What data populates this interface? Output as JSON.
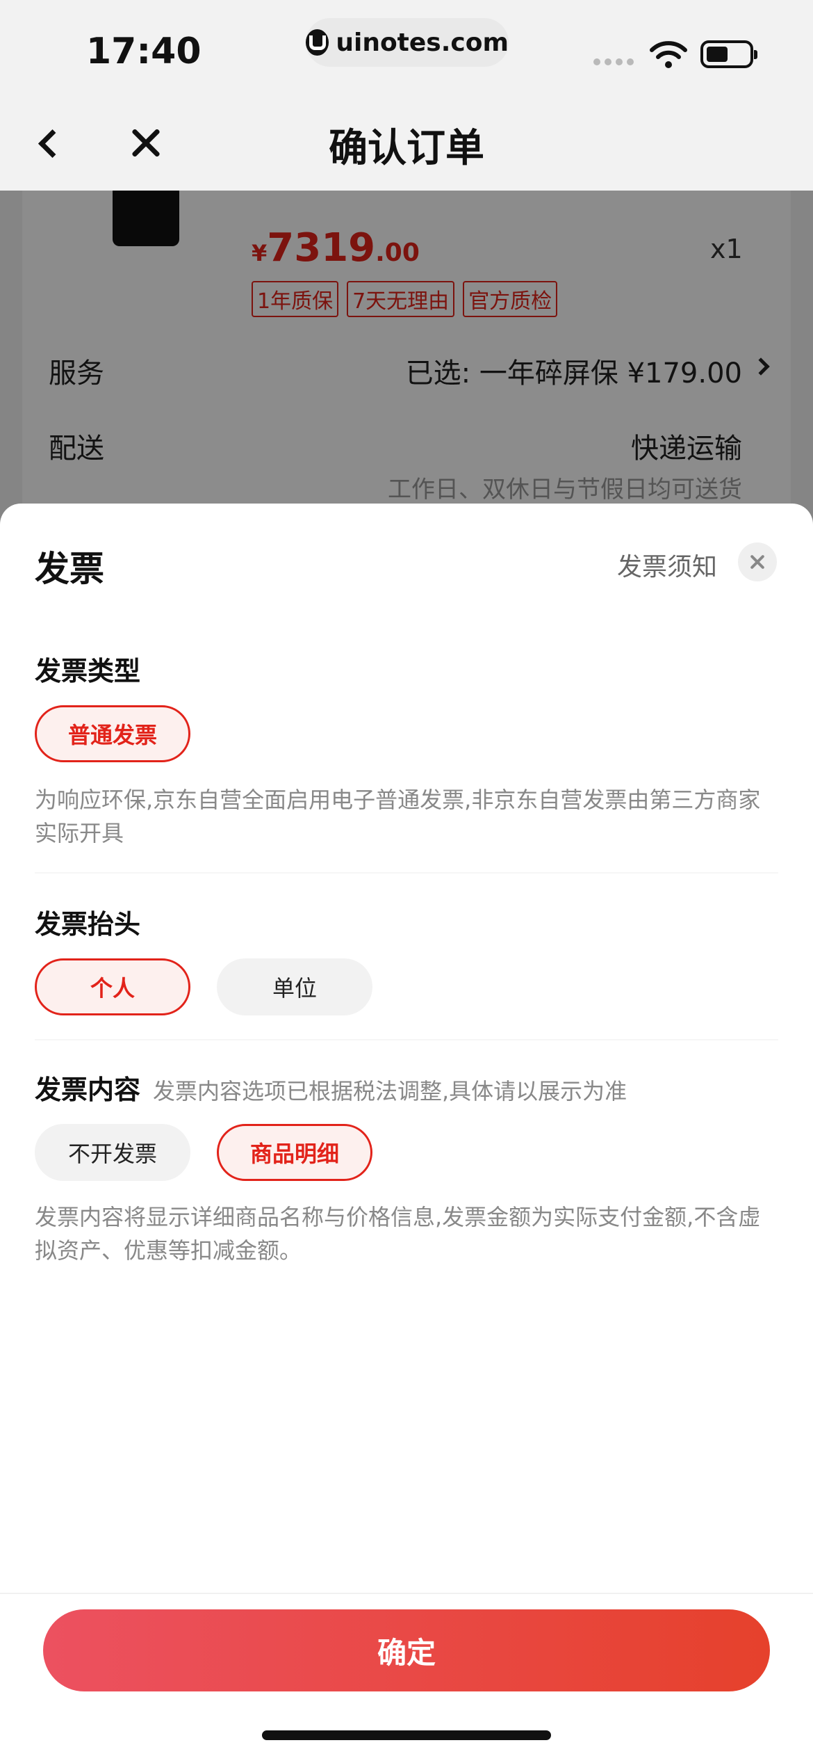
{
  "status_bar": {
    "time": "17:40",
    "url": "uinotes.com"
  },
  "nav": {
    "title": "确认订单"
  },
  "order": {
    "price_symbol": "¥",
    "price_integer": "7319",
    "price_decimal": ".00",
    "quantity": "x1",
    "tags": [
      "1年质保",
      "7天无理由",
      "官方质检"
    ],
    "service_label": "服务",
    "service_value": "已选: 一年碎屏保  ¥179.00",
    "delivery_label": "配送",
    "delivery_value": "快递运输",
    "delivery_note": "工作日、双休日与节假日均可送货"
  },
  "sheet": {
    "title": "发票",
    "notice_link": "发票须知",
    "invoice_type": {
      "title": "发票类型",
      "options": [
        "普通发票"
      ],
      "selected": "普通发票",
      "description": "为响应环保,京东自营全面启用电子普通发票,非京东自营发票由第三方商家实际开具"
    },
    "invoice_header": {
      "title": "发票抬头",
      "options": [
        "个人",
        "单位"
      ],
      "selected": "个人"
    },
    "invoice_content": {
      "title": "发票内容",
      "hint": "发票内容选项已根据税法调整,具体请以展示为准",
      "options": [
        "不开发票",
        "商品明细"
      ],
      "selected": "商品明细",
      "description": "发票内容将显示详细商品名称与价格信息,发票金额为实际支付金额,不含虚拟资产、优惠等扣减金额。"
    },
    "confirm_label": "确定"
  },
  "colors": {
    "accent": "#e2231a",
    "button_start": "#ec5160",
    "button_end": "#e6412c"
  }
}
